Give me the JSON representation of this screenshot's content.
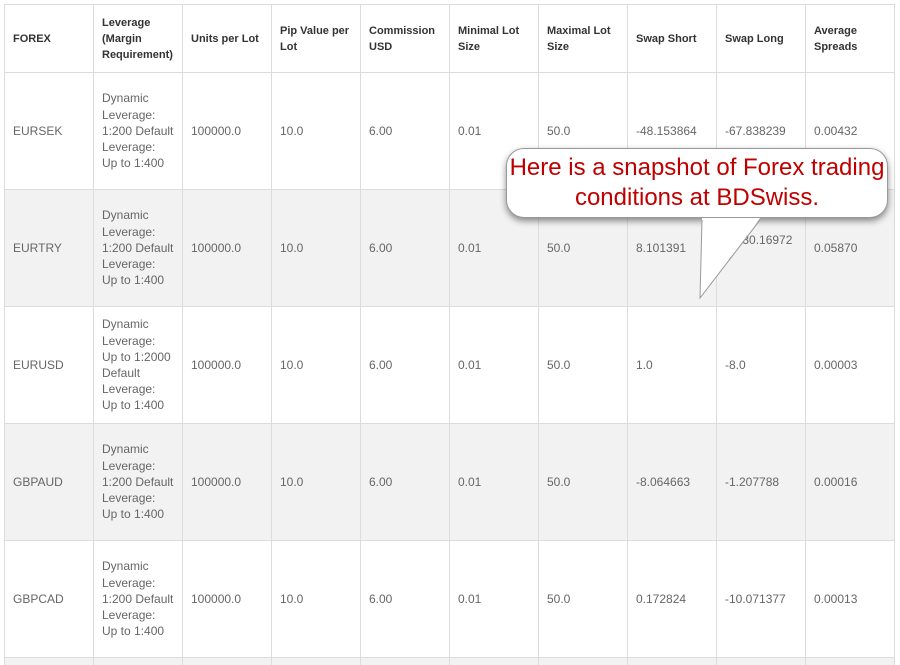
{
  "table": {
    "headers": [
      "FOREX",
      "Leverage (Margin Requirement)",
      "Units per Lot",
      "Pip Value per Lot",
      "Commission USD",
      "Minimal Lot Size",
      "Maximal Lot Size",
      "Swap Short",
      "Swap Long",
      "Average Spreads"
    ],
    "rows": [
      [
        "EURSEK",
        "Dynamic Leverage: 1:200 Default Leverage: Up to 1:400",
        "100000.0",
        "10.0",
        "6.00",
        "0.01",
        "50.0",
        "-48.153864",
        "-67.838239",
        "0.00432"
      ],
      [
        "EURTRY",
        "Dynamic Leverage: 1:200 Default Leverage: Up to 1:400",
        "100000.0",
        "10.0",
        "6.00",
        "0.01",
        "50.0",
        "8.101391",
        "-3630.16972 9",
        "0.05870"
      ],
      [
        "EURUSD",
        "Dynamic Leverage: Up to 1:2000 Default Leverage: Up to 1:400",
        "100000.0",
        "10.0",
        "6.00",
        "0.01",
        "50.0",
        "1.0",
        "-8.0",
        "0.00003"
      ],
      [
        "GBPAUD",
        "Dynamic Leverage: 1:200 Default Leverage: Up to 1:400",
        "100000.0",
        "10.0",
        "6.00",
        "0.01",
        "50.0",
        "-8.064663",
        "-1.207788",
        "0.00016"
      ],
      [
        "GBPCAD",
        "Dynamic Leverage: 1:200 Default Leverage: Up to 1:400",
        "100000.0",
        "10.0",
        "6.00",
        "0.01",
        "50.0",
        "0.172824",
        "-10.071377",
        "0.00013"
      ]
    ]
  },
  "callout": {
    "text": "Here is a snapshot of Forex trading conditions at BDSwiss.",
    "text_color": "#c00000"
  },
  "colors": {
    "row_alt": "#f2f2f2",
    "border": "#dcdcdc",
    "header_text": "#333333",
    "cell_text": "#666666"
  }
}
